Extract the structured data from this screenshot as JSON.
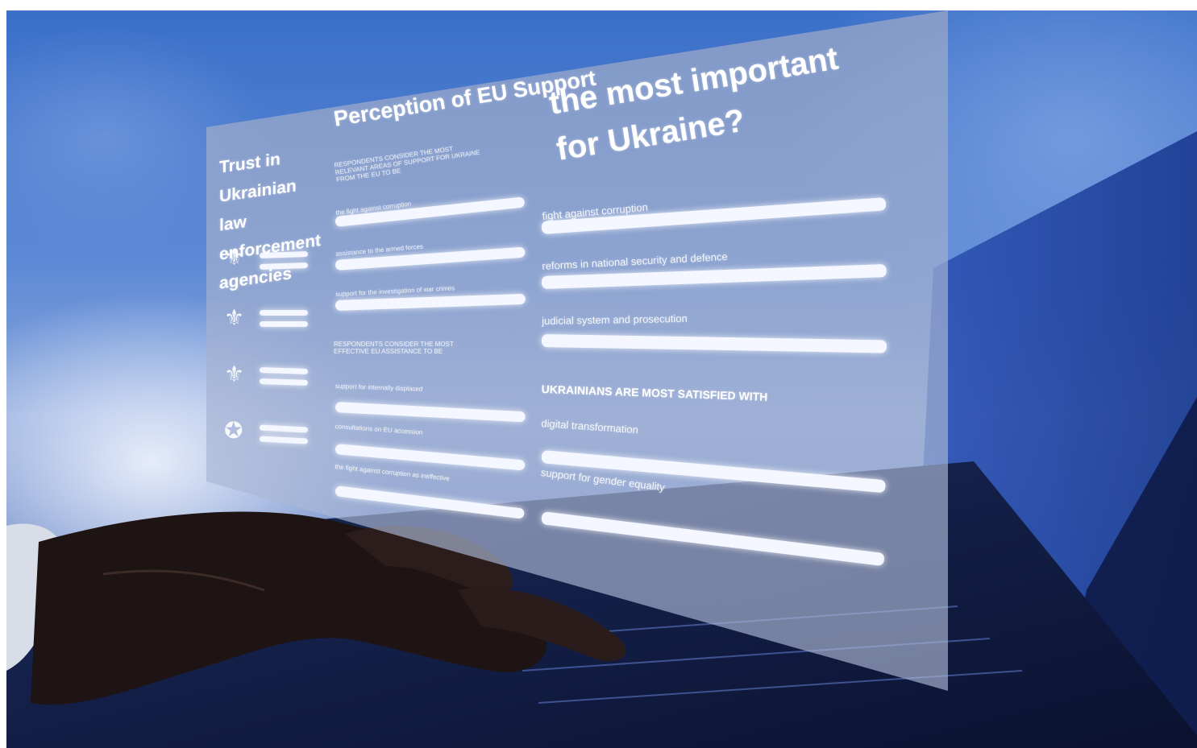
{
  "panel": {
    "left_title": "Trust in Ukrainian law enforcement agencies",
    "middle_title": "Perception of EU Support",
    "middle_subtitle_1": "RESPONDENTS CONSIDER THE MOST RELEVANT AREAS OF SUPPORT FOR UKRAINE FROM THE EU TO BE",
    "middle_items_1": [
      "the fight against corruption",
      "assistance to the armed forces",
      "support for the investigation of war crimes"
    ],
    "middle_subtitle_2": "RESPONDENTS CONSIDER THE MOST EFFECTIVE EU ASSISTANCE TO BE",
    "middle_items_2": [
      "support for internally displaced",
      "consultations on EU accession",
      "the fight against corruption as ineffective"
    ],
    "right_title": "Which reforms are the most important for Ukraine?",
    "right_items_1": [
      "fight against corruption",
      "reforms in national security and defence",
      "judicial system and prosecution"
    ],
    "right_subtitle": "UKRAINIANS ARE MOST SATISFIED WITH",
    "right_items_2": [
      "digital transformation",
      "support for gender equality"
    ]
  }
}
